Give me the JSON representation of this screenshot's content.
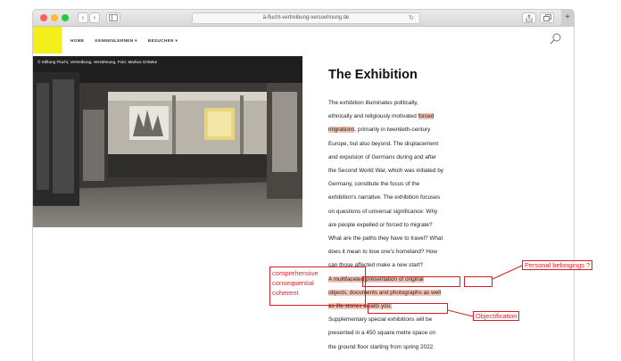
{
  "browser": {
    "url": "ä-flucht-vertreibung-versoehnung.de",
    "back_glyph": "‹",
    "forward_glyph": "›",
    "reload_glyph": "↻",
    "new_tab_glyph": "+"
  },
  "site": {
    "nav": [
      {
        "label": "HOME"
      },
      {
        "label": "KENNENLERNEN ▾"
      },
      {
        "label": "BESUCHEN ▾"
      }
    ]
  },
  "photo": {
    "credit": "© Stiftung Flucht, Vertreibung, Versöhnung, Foto: Markus Gröteke"
  },
  "article": {
    "title": "The Exhibition",
    "lines": [
      {
        "pre": "The exhibition illuminates politically,",
        "hl": "",
        "post": ""
      },
      {
        "pre": "ethnically and religiously motivated ",
        "hl": "forced",
        "post": ""
      },
      {
        "pre": "",
        "hl": "migrations",
        "post": ", primarily in twentieth-century"
      },
      {
        "pre": "Europe, but also beyond. The displacement",
        "hl": "",
        "post": ""
      },
      {
        "pre": "and expulsion of Germans during and after",
        "hl": "",
        "post": ""
      },
      {
        "pre": "the Second World War, which was initiated by",
        "hl": "",
        "post": ""
      },
      {
        "pre": "Germany, constitute the focus of the",
        "hl": "",
        "post": ""
      },
      {
        "pre": "exhibition's narrative. The exhibition focuses",
        "hl": "",
        "post": ""
      },
      {
        "pre": "on questions of universal significance: Why",
        "hl": "",
        "post": ""
      },
      {
        "pre": "are people expelled or forced to migrate?",
        "hl": "",
        "post": ""
      },
      {
        "pre": "What are the paths they have to travel? What",
        "hl": "",
        "post": ""
      },
      {
        "pre": "does it mean to lose one's homeland? How",
        "hl": "",
        "post": ""
      },
      {
        "pre": "can those affected make a new start?",
        "hl": "",
        "post": ""
      },
      {
        "pre": "",
        "hl": "A multifaceted presentation of original",
        "post": ""
      },
      {
        "pre": "",
        "hl": "objects, documents and photographs as well",
        "post": ""
      },
      {
        "pre": "",
        "hl": "as life stories awaits you.",
        "post": ""
      },
      {
        "pre": "Supplementary special exhibitions will be",
        "hl": "",
        "post": ""
      },
      {
        "pre": "presented in a 450 square metre space on",
        "hl": "",
        "post": ""
      },
      {
        "pre": "the ground floor starting from spring 2022.",
        "hl": "",
        "post": ""
      }
    ]
  },
  "annotations": {
    "synonyms": [
      "comprehensive",
      "consequential",
      "coherent"
    ],
    "personal": "Personal belongings ?",
    "objectification": "Objectification"
  },
  "colors": {
    "highlight": "#f5c4b4",
    "annotation_red": "#d81e27",
    "logo_yellow": "#f4ee1b"
  }
}
